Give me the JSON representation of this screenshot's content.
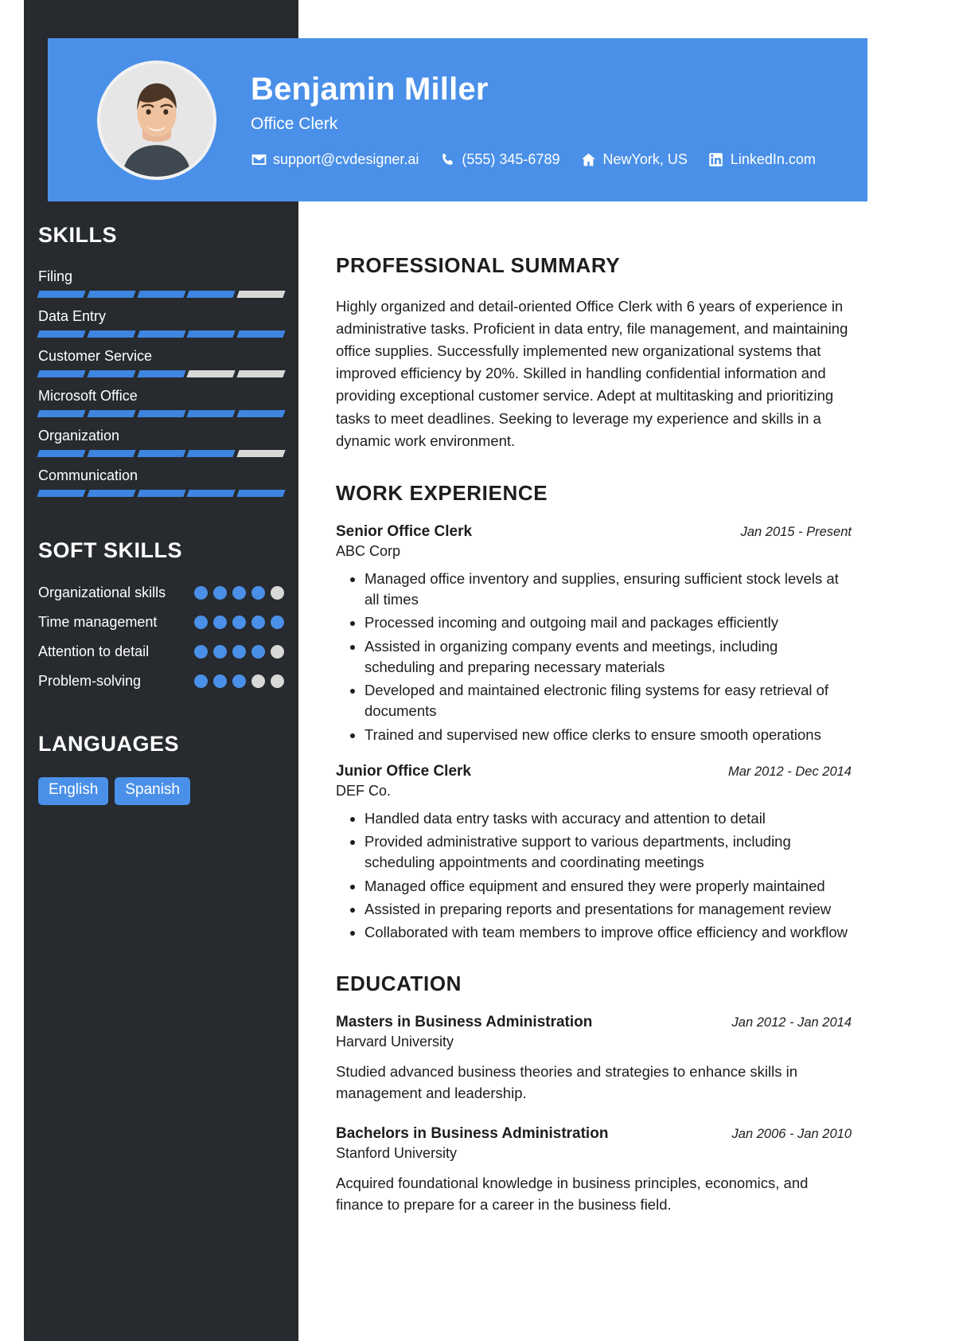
{
  "header": {
    "name": "Benjamin Miller",
    "role": "Office Clerk",
    "accent_color": "#4a90e8",
    "sidebar_color": "#272a2e",
    "contacts": [
      {
        "icon": "envelope-icon",
        "label": "support@cvdesigner.ai"
      },
      {
        "icon": "phone-icon",
        "label": "(555) 345-6789"
      },
      {
        "icon": "home-icon",
        "label": "NewYork, US"
      },
      {
        "icon": "linkedin-icon",
        "label": "LinkedIn.com"
      }
    ]
  },
  "sidebar": {
    "skills_heading": "SKILLS",
    "skills": [
      {
        "name": "Filing",
        "level": 4,
        "max": 5
      },
      {
        "name": "Data Entry",
        "level": 5,
        "max": 5
      },
      {
        "name": "Customer Service",
        "level": 3,
        "max": 5
      },
      {
        "name": "Microsoft Office",
        "level": 5,
        "max": 5
      },
      {
        "name": "Organization",
        "level": 4,
        "max": 5
      },
      {
        "name": "Communication",
        "level": 5,
        "max": 5
      }
    ],
    "soft_skills_heading": "SOFT SKILLS",
    "soft_skills": [
      {
        "name": "Organizational skills",
        "level": 4,
        "max": 5
      },
      {
        "name": "Time management",
        "level": 5,
        "max": 5
      },
      {
        "name": "Attention to detail",
        "level": 4,
        "max": 5
      },
      {
        "name": "Problem-solving",
        "level": 3,
        "max": 5
      }
    ],
    "languages_heading": "LANGUAGES",
    "languages": [
      "English",
      "Spanish"
    ]
  },
  "main": {
    "summary_heading": "PROFESSIONAL SUMMARY",
    "summary_text": "Highly organized and detail-oriented Office Clerk with 6 years of experience in administrative tasks. Proficient in data entry, file management, and maintaining office supplies. Successfully implemented new organizational systems that improved efficiency by 20%. Skilled in handling confidential information and providing exceptional customer service. Adept at multitasking and prioritizing tasks to meet deadlines. Seeking to leverage my experience and skills in a dynamic work environment.",
    "work_heading": "WORK EXPERIENCE",
    "work": [
      {
        "title": "Senior Office Clerk",
        "company": "ABC Corp",
        "date": "Jan 2015 - Present",
        "bullets": [
          "Managed office inventory and supplies, ensuring sufficient stock levels at all times",
          "Processed incoming and outgoing mail and packages efficiently",
          "Assisted in organizing company events and meetings, including scheduling and preparing necessary materials",
          "Developed and maintained electronic filing systems for easy retrieval of documents",
          "Trained and supervised new office clerks to ensure smooth operations"
        ]
      },
      {
        "title": "Junior Office Clerk",
        "company": "DEF Co.",
        "date": "Mar 2012 - Dec 2014",
        "bullets": [
          "Handled data entry tasks with accuracy and attention to detail",
          "Provided administrative support to various departments, including scheduling appointments and coordinating meetings",
          "Managed office equipment and ensured they were properly maintained",
          "Assisted in preparing reports and presentations for management review",
          "Collaborated with team members to improve office efficiency and workflow"
        ]
      }
    ],
    "education_heading": "EDUCATION",
    "education": [
      {
        "degree": "Masters in Business Administration",
        "school": "Harvard University",
        "date": "Jan 2012 - Jan 2014",
        "description": "Studied advanced business theories and strategies to enhance skills in management and leadership."
      },
      {
        "degree": "Bachelors in Business Administration",
        "school": "Stanford University",
        "date": "Jan 2006 - Jan 2010",
        "description": "Acquired foundational knowledge in business principles, economics, and finance to prepare for a career in the business field."
      }
    ]
  }
}
